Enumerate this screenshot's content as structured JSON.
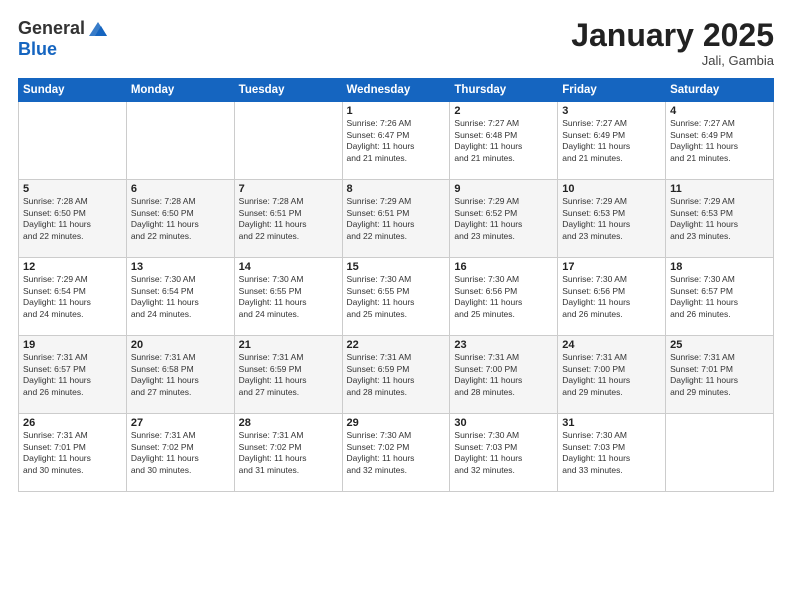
{
  "header": {
    "logo_general": "General",
    "logo_blue": "Blue",
    "month": "January 2025",
    "location": "Jali, Gambia"
  },
  "days_of_week": [
    "Sunday",
    "Monday",
    "Tuesday",
    "Wednesday",
    "Thursday",
    "Friday",
    "Saturday"
  ],
  "weeks": [
    [
      {
        "num": "",
        "info": ""
      },
      {
        "num": "",
        "info": ""
      },
      {
        "num": "",
        "info": ""
      },
      {
        "num": "1",
        "info": "Sunrise: 7:26 AM\nSunset: 6:47 PM\nDaylight: 11 hours\nand 21 minutes."
      },
      {
        "num": "2",
        "info": "Sunrise: 7:27 AM\nSunset: 6:48 PM\nDaylight: 11 hours\nand 21 minutes."
      },
      {
        "num": "3",
        "info": "Sunrise: 7:27 AM\nSunset: 6:49 PM\nDaylight: 11 hours\nand 21 minutes."
      },
      {
        "num": "4",
        "info": "Sunrise: 7:27 AM\nSunset: 6:49 PM\nDaylight: 11 hours\nand 21 minutes."
      }
    ],
    [
      {
        "num": "5",
        "info": "Sunrise: 7:28 AM\nSunset: 6:50 PM\nDaylight: 11 hours\nand 22 minutes."
      },
      {
        "num": "6",
        "info": "Sunrise: 7:28 AM\nSunset: 6:50 PM\nDaylight: 11 hours\nand 22 minutes."
      },
      {
        "num": "7",
        "info": "Sunrise: 7:28 AM\nSunset: 6:51 PM\nDaylight: 11 hours\nand 22 minutes."
      },
      {
        "num": "8",
        "info": "Sunrise: 7:29 AM\nSunset: 6:51 PM\nDaylight: 11 hours\nand 22 minutes."
      },
      {
        "num": "9",
        "info": "Sunrise: 7:29 AM\nSunset: 6:52 PM\nDaylight: 11 hours\nand 23 minutes."
      },
      {
        "num": "10",
        "info": "Sunrise: 7:29 AM\nSunset: 6:53 PM\nDaylight: 11 hours\nand 23 minutes."
      },
      {
        "num": "11",
        "info": "Sunrise: 7:29 AM\nSunset: 6:53 PM\nDaylight: 11 hours\nand 23 minutes."
      }
    ],
    [
      {
        "num": "12",
        "info": "Sunrise: 7:29 AM\nSunset: 6:54 PM\nDaylight: 11 hours\nand 24 minutes."
      },
      {
        "num": "13",
        "info": "Sunrise: 7:30 AM\nSunset: 6:54 PM\nDaylight: 11 hours\nand 24 minutes."
      },
      {
        "num": "14",
        "info": "Sunrise: 7:30 AM\nSunset: 6:55 PM\nDaylight: 11 hours\nand 24 minutes."
      },
      {
        "num": "15",
        "info": "Sunrise: 7:30 AM\nSunset: 6:55 PM\nDaylight: 11 hours\nand 25 minutes."
      },
      {
        "num": "16",
        "info": "Sunrise: 7:30 AM\nSunset: 6:56 PM\nDaylight: 11 hours\nand 25 minutes."
      },
      {
        "num": "17",
        "info": "Sunrise: 7:30 AM\nSunset: 6:56 PM\nDaylight: 11 hours\nand 26 minutes."
      },
      {
        "num": "18",
        "info": "Sunrise: 7:30 AM\nSunset: 6:57 PM\nDaylight: 11 hours\nand 26 minutes."
      }
    ],
    [
      {
        "num": "19",
        "info": "Sunrise: 7:31 AM\nSunset: 6:57 PM\nDaylight: 11 hours\nand 26 minutes."
      },
      {
        "num": "20",
        "info": "Sunrise: 7:31 AM\nSunset: 6:58 PM\nDaylight: 11 hours\nand 27 minutes."
      },
      {
        "num": "21",
        "info": "Sunrise: 7:31 AM\nSunset: 6:59 PM\nDaylight: 11 hours\nand 27 minutes."
      },
      {
        "num": "22",
        "info": "Sunrise: 7:31 AM\nSunset: 6:59 PM\nDaylight: 11 hours\nand 28 minutes."
      },
      {
        "num": "23",
        "info": "Sunrise: 7:31 AM\nSunset: 7:00 PM\nDaylight: 11 hours\nand 28 minutes."
      },
      {
        "num": "24",
        "info": "Sunrise: 7:31 AM\nSunset: 7:00 PM\nDaylight: 11 hours\nand 29 minutes."
      },
      {
        "num": "25",
        "info": "Sunrise: 7:31 AM\nSunset: 7:01 PM\nDaylight: 11 hours\nand 29 minutes."
      }
    ],
    [
      {
        "num": "26",
        "info": "Sunrise: 7:31 AM\nSunset: 7:01 PM\nDaylight: 11 hours\nand 30 minutes."
      },
      {
        "num": "27",
        "info": "Sunrise: 7:31 AM\nSunset: 7:02 PM\nDaylight: 11 hours\nand 30 minutes."
      },
      {
        "num": "28",
        "info": "Sunrise: 7:31 AM\nSunset: 7:02 PM\nDaylight: 11 hours\nand 31 minutes."
      },
      {
        "num": "29",
        "info": "Sunrise: 7:30 AM\nSunset: 7:02 PM\nDaylight: 11 hours\nand 32 minutes."
      },
      {
        "num": "30",
        "info": "Sunrise: 7:30 AM\nSunset: 7:03 PM\nDaylight: 11 hours\nand 32 minutes."
      },
      {
        "num": "31",
        "info": "Sunrise: 7:30 AM\nSunset: 7:03 PM\nDaylight: 11 hours\nand 33 minutes."
      },
      {
        "num": "",
        "info": ""
      }
    ]
  ]
}
